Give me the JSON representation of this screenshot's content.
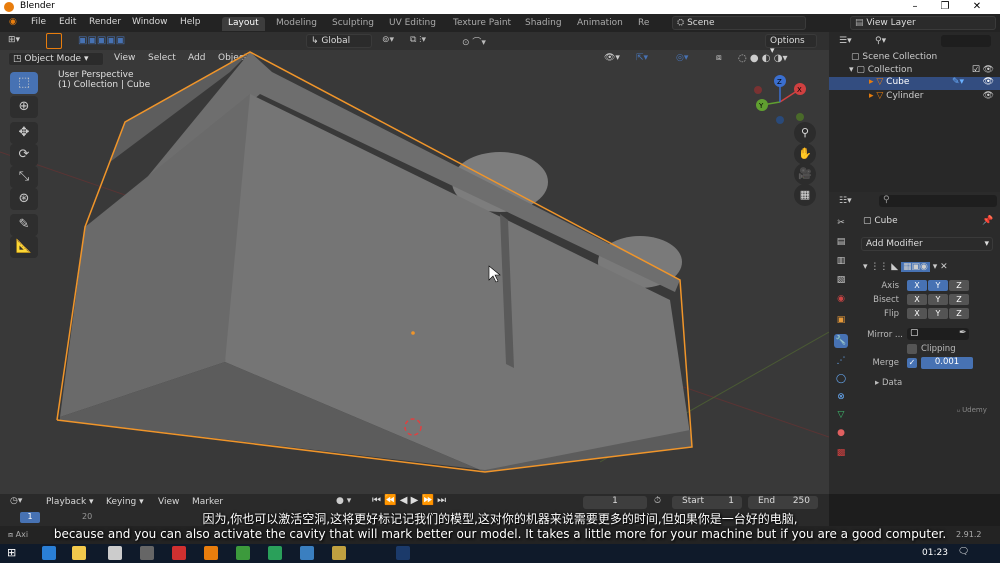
{
  "window": {
    "title": "Blender",
    "version": "2.91.2"
  },
  "menu": [
    "File",
    "Edit",
    "Render",
    "Window",
    "Help"
  ],
  "workspaces": [
    "Layout",
    "Modeling",
    "Sculpting",
    "UV Editing",
    "Texture Paint",
    "Shading",
    "Animation",
    "Re"
  ],
  "scene": "Scene",
  "view_layer": "View Layer",
  "viewport": {
    "transform": "Global",
    "options": "Options",
    "mode": "Object Mode",
    "menu": [
      "View",
      "Select",
      "Add",
      "Object"
    ],
    "info_line1": "User Perspective",
    "info_line2": "(1) Collection | Cube",
    "gizmo": {
      "x": "X",
      "y": "Y",
      "z": "Z"
    }
  },
  "outliner": {
    "root": "Scene Collection",
    "collection": "Collection",
    "items": [
      "Cube",
      "Cylinder"
    ]
  },
  "properties": {
    "object": "Cube",
    "add_modifier": "Add Modifier",
    "axis_label": "Axis",
    "bisect_label": "Bisect",
    "flip_label": "Flip",
    "mirror_label": "Mirror ...",
    "clipping_label": "Clipping",
    "merge_label": "Merge",
    "merge_value": "0.001",
    "data_label": "Data",
    "xyz": [
      "X",
      "Y",
      "Z"
    ],
    "watermark": "Udemy"
  },
  "timeline": {
    "menu": [
      "Playback",
      "Keying",
      "View",
      "Marker"
    ],
    "current_frame": "1",
    "start_label": "Start",
    "start": "1",
    "end_label": "End",
    "end": "250",
    "ruler": [
      "1",
      "20"
    ]
  },
  "status": {
    "left": "Axi"
  },
  "taskbar": {
    "time": "01:23"
  },
  "subtitles": {
    "chinese": "因为,你也可以激活空洞,这将更好标记记我们的模型,这对你的机器来说需要更多的时间,但如果你是一台好的电脑,",
    "english": "because and you can also activate the cavity that will mark better our model. It takes a little more for your machine but if you are a good computer."
  }
}
